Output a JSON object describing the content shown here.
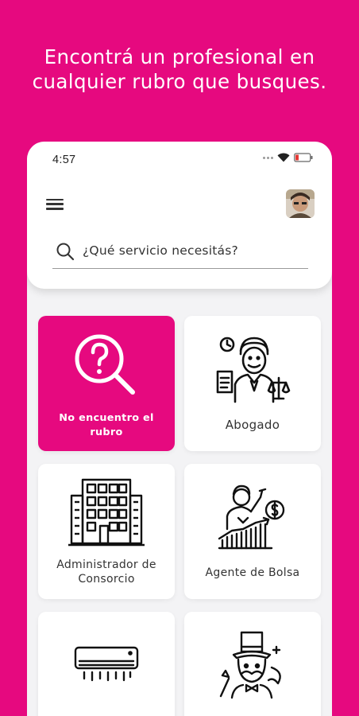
{
  "headline": {
    "line1": "Encontrá un profesional en",
    "line2": "cualquier rubro que busques."
  },
  "status_bar": {
    "time": "4:57",
    "icons": [
      "signal-dots-icon",
      "wifi-icon",
      "battery-icon"
    ]
  },
  "header": {
    "menu_icon": "hamburger-menu-icon",
    "avatar": "user-avatar-photo"
  },
  "search": {
    "icon": "search-icon",
    "placeholder": "¿Qué servicio necesitás?"
  },
  "categories": [
    {
      "label_line1": "No encuentro el",
      "label_line2": "rubro",
      "icon": "question-magnifier-icon",
      "highlighted": true
    },
    {
      "label_line1": "Abogado",
      "icon": "lawyer-icon"
    },
    {
      "label_line1": "Administrador de",
      "label_line2": "Consorcio",
      "icon": "building-icon"
    },
    {
      "label_line1": "Agente de Bolsa",
      "icon": "stock-broker-icon"
    },
    {
      "label_line1": "",
      "icon": "air-conditioner-icon"
    },
    {
      "label_line1": "",
      "icon": "magician-icon"
    }
  ],
  "colors": {
    "brand": "#E6097F",
    "card": "#ffffff",
    "background": "#f3f3f5"
  }
}
